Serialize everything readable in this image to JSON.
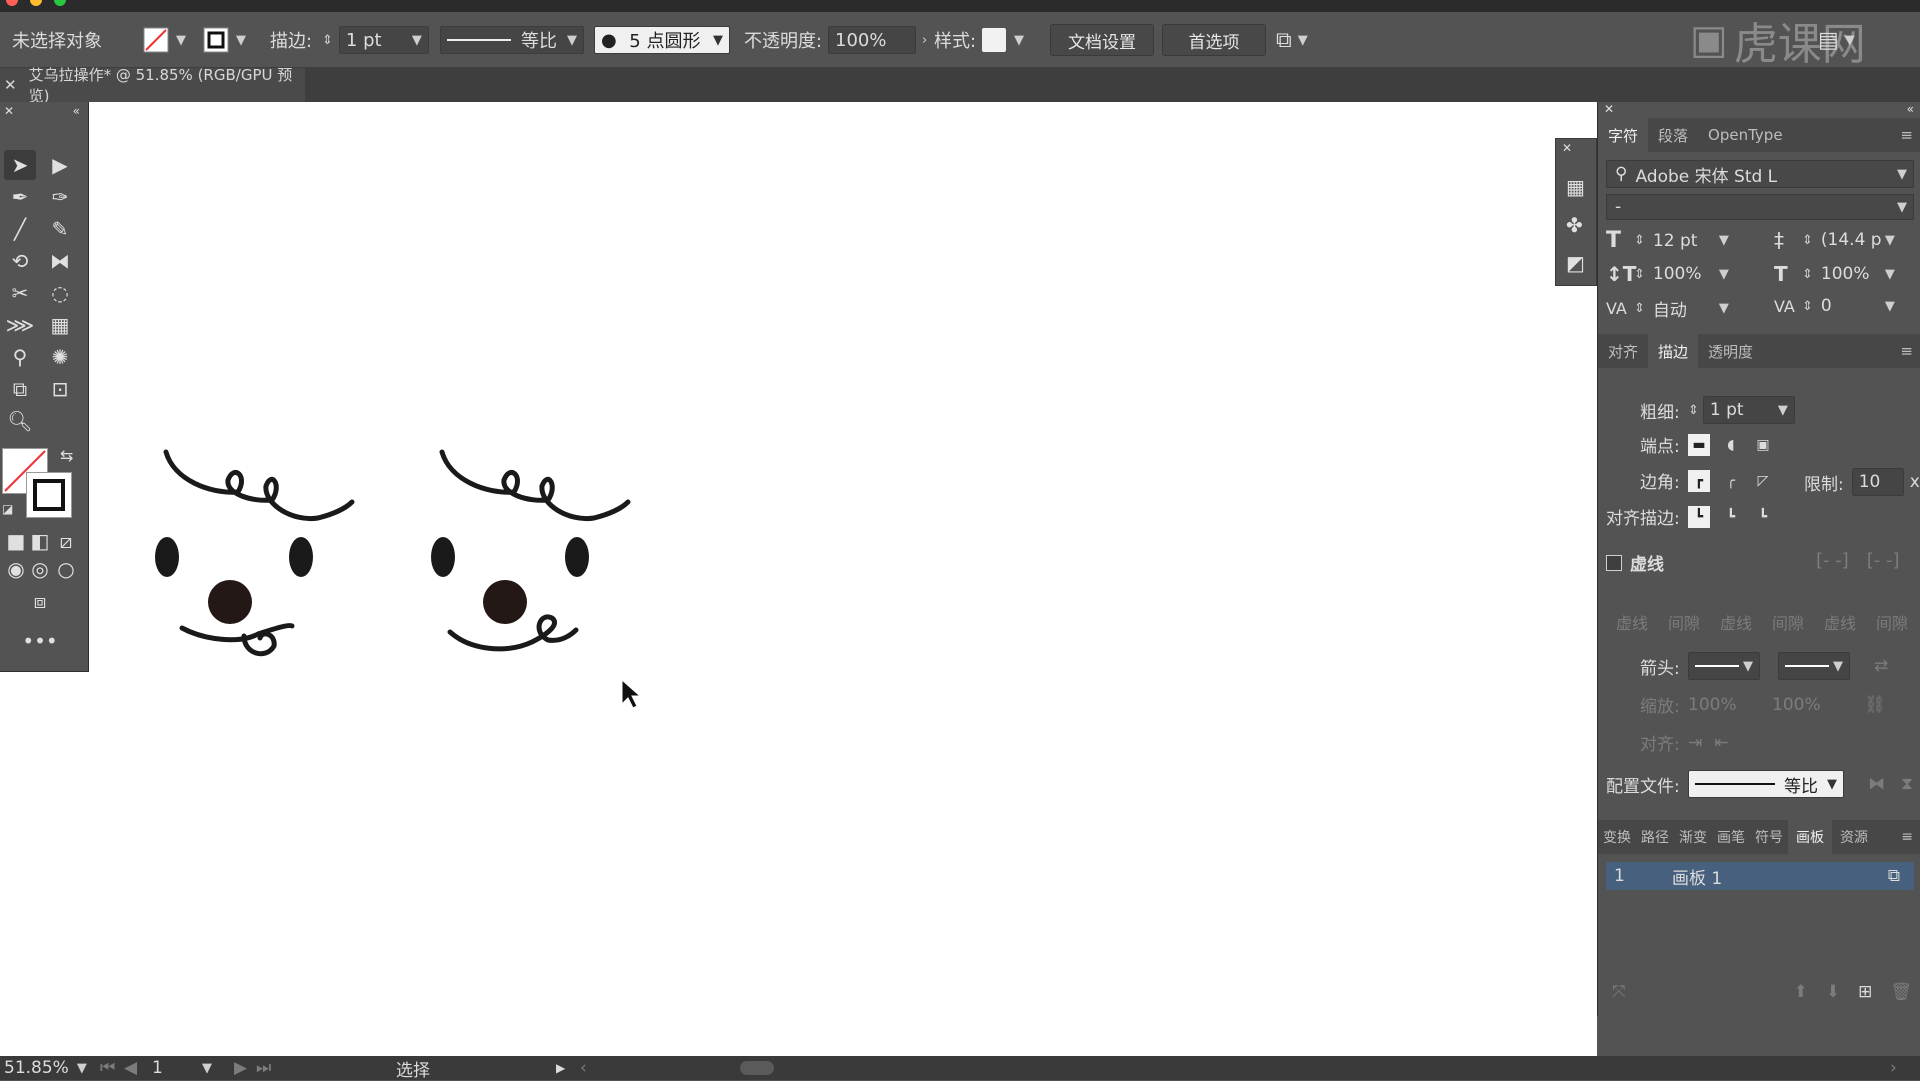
{
  "control_bar": {
    "selection_label": "未选择对象",
    "stroke_label": "描边:",
    "stroke_value": "1 pt",
    "profile_label": "等比",
    "brush_label": "5 点圆形",
    "opacity_label": "不透明度:",
    "opacity_value": "100%",
    "style_label": "样式:",
    "doc_setup_button": "文档设置",
    "prefs_button": "首选项"
  },
  "document_tab": {
    "title": "艾乌拉操作* @ 51.85% (RGB/GPU 预览)"
  },
  "watermark": {
    "text": "虎课网"
  },
  "character_panel": {
    "tabs": [
      "字符",
      "段落",
      "OpenType"
    ],
    "font_family": "Adobe 宋体 Std L",
    "font_style": "-",
    "font_size": "12 pt",
    "leading": "(14.4 p",
    "vertical_scale": "100%",
    "horizontal_scale": "100%",
    "kerning": "自动",
    "tracking": "0"
  },
  "stroke_panel": {
    "tabs": [
      "对齐",
      "描边",
      "透明度"
    ],
    "weight_label": "粗细:",
    "weight_value": "1 pt",
    "cap_label": "端点:",
    "corner_label": "边角:",
    "limit_label": "限制:",
    "limit_value": "10",
    "limit_unit": "x",
    "align_label": "对齐描边:",
    "dashed_label": "虚线",
    "dash_fields": [
      "虚线",
      "间隙",
      "虚线",
      "间隙",
      "虚线",
      "间隙"
    ],
    "arrow_label": "箭头:",
    "scale_label": "缩放:",
    "scale_values": [
      "100%",
      "100%"
    ],
    "align_arrow_label": "对齐:",
    "profile_label": "配置文件:",
    "profile_value": "等比"
  },
  "artboard_panel": {
    "tabs": [
      "变换",
      "路径",
      "渐变",
      "画笔",
      "符号",
      "画板",
      "资源"
    ],
    "rows": [
      {
        "index": "1",
        "name": "画板 1"
      }
    ]
  },
  "status_bar": {
    "zoom": "51.85%",
    "page": "1",
    "tool_label": "选择"
  },
  "colors": {
    "ui_bg": "#535353",
    "canvas": "#ffffff",
    "ink": "#1a1a1a"
  }
}
